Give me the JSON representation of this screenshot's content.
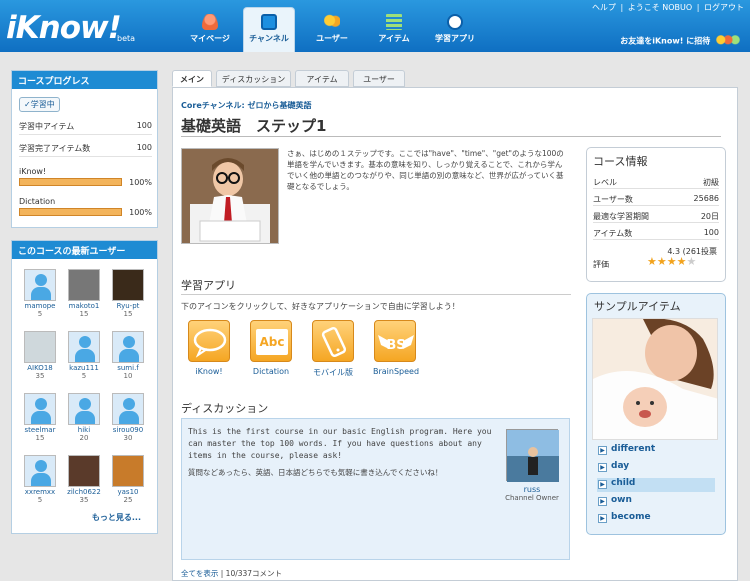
{
  "header": {
    "logo": "iKnow!",
    "beta": "beta",
    "nav": [
      {
        "label": "マイページ",
        "icon": "person-icon"
      },
      {
        "label": "チャンネル",
        "icon": "tv-icon",
        "active": true
      },
      {
        "label": "ユーザー",
        "icon": "users-icon"
      },
      {
        "label": "アイテム",
        "icon": "list-icon"
      },
      {
        "label": "学習アプリ",
        "icon": "app-icon"
      }
    ],
    "top_links": [
      "ヘルプ",
      "|",
      "ようこそ NOBUO",
      "|",
      "ログアウト"
    ],
    "invite": "お友達をiKnow! に招待"
  },
  "progress": {
    "title": "コースプログレス",
    "badge": "✓学習中",
    "rows": [
      {
        "label": "学習中アイテム",
        "value": "100"
      },
      {
        "label": "学習完了アイテム数",
        "value": "100"
      }
    ],
    "bars": [
      {
        "label": "iKnow!",
        "value": "100%",
        "fraction": 1.0
      },
      {
        "label": "Dictation",
        "value": "100%",
        "fraction": 1.0
      }
    ]
  },
  "users": {
    "title": "このコースの最新ユーザー",
    "list": [
      {
        "name": "mamope",
        "count": "5"
      },
      {
        "name": "makoto1",
        "count": "15"
      },
      {
        "name": "Ryu-pt",
        "count": "15"
      },
      {
        "name": "AIKO18",
        "count": "35"
      },
      {
        "name": "kazu111",
        "count": "5"
      },
      {
        "name": "sumi.f",
        "count": "10"
      },
      {
        "name": "steelmar",
        "count": "15"
      },
      {
        "name": "hiki",
        "count": "20"
      },
      {
        "name": "sirou090",
        "count": "30"
      },
      {
        "name": "xxremxx",
        "count": "5"
      },
      {
        "name": "zilch0622",
        "count": "35"
      },
      {
        "name": "yas10",
        "count": "25"
      }
    ],
    "more": "もっと見る..."
  },
  "tabs": [
    "メイン",
    "ディスカッション",
    "アイテム",
    "ユーザー"
  ],
  "course": {
    "crumb": "Coreチャンネル: ゼロから基礎英語",
    "title": "基礎英語　ステップ1",
    "description": "さぁ、はじめの１ステップです。ここでは\"have\"、\"time\"、\"get\"のような100の単語を学んでいきます。基本の意味を知り、しっかり覚えることで、これから学んでいく他の単語とのつながりや、同じ単語の別の意味など、世界が広がっていく基礎となるでしょう。"
  },
  "info": {
    "title": "コース情報",
    "rows": [
      {
        "label": "レベル",
        "value": "初級"
      },
      {
        "label": "ユーザー数",
        "value": "25686"
      },
      {
        "label": "最適な学習期間",
        "value": "20日"
      },
      {
        "label": "アイテム数",
        "value": "100"
      }
    ],
    "rating_text": "4.3 (261投票",
    "rating_label": "評価",
    "rating_stars": 4
  },
  "sample": {
    "title": "サンプルアイテム",
    "items": [
      "different",
      "day",
      "child",
      "own",
      "become"
    ],
    "selected": "child"
  },
  "apps": {
    "title": "学習アプリ",
    "desc": "下のアイコンをクリックして、好きなアプリケーションで自由に学習しよう！",
    "list": [
      {
        "label": "iKnow!",
        "icon_text": ""
      },
      {
        "label": "Dictation",
        "icon_text": "Abc"
      },
      {
        "label": "モバイル版",
        "icon_text": ""
      },
      {
        "label": "BrainSpeed",
        "icon_text": "BS"
      }
    ]
  },
  "discussion": {
    "title": "ディスカッション",
    "text_en": "This is the first course in our basic English program. Here you can master the top 100 words. If you have questions about any items in the course, please ask!",
    "text_ja": "質問などあったら、英語、日本語どちらでも気軽に書き込んでくださいね！",
    "owner_name": "russ",
    "owner_role": "Channel Owner",
    "show_all": "全てを表示",
    "comment_count": "10/337コメント"
  }
}
